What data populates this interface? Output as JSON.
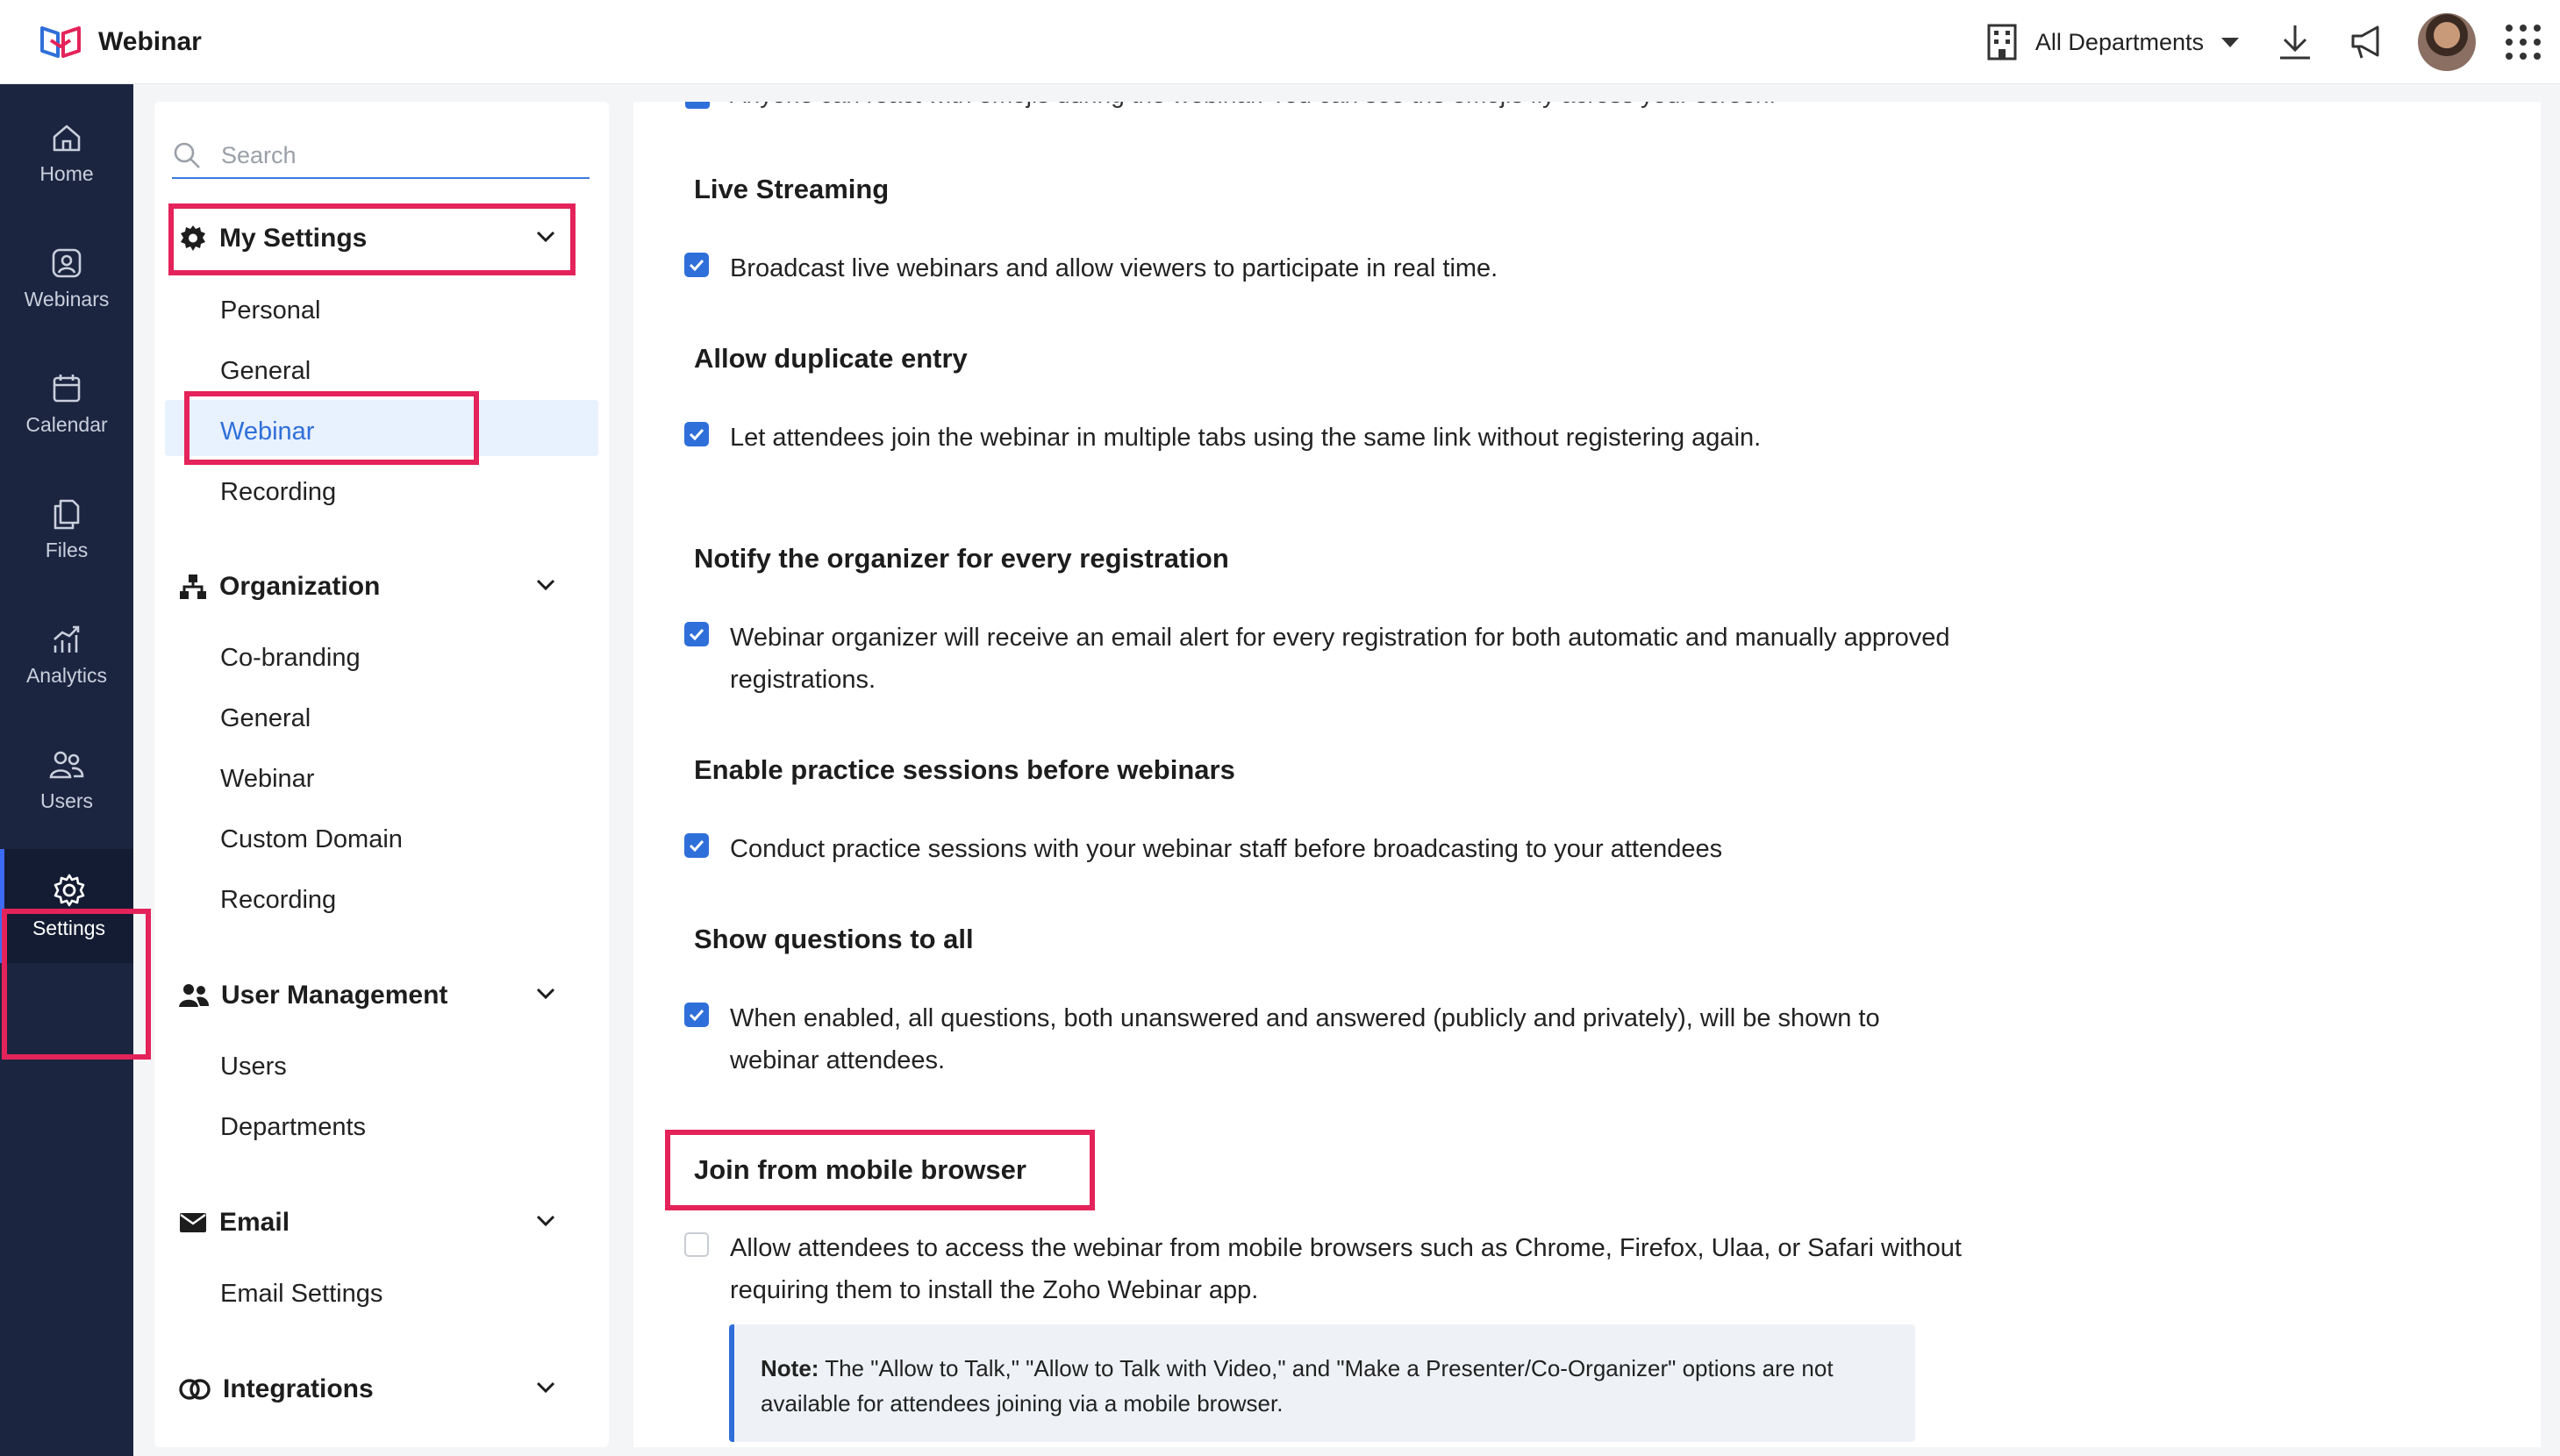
{
  "app": {
    "name": "Webinar",
    "brand_color": "#e4235a"
  },
  "topbar": {
    "department_selector": "All Departments",
    "icons": [
      "building-icon",
      "download-icon",
      "announcement-icon",
      "avatar",
      "apps-grid-icon"
    ]
  },
  "rail": {
    "items": [
      {
        "label": "Home",
        "icon": "home-icon"
      },
      {
        "label": "Webinars",
        "icon": "webinars-icon"
      },
      {
        "label": "Calendar",
        "icon": "calendar-icon"
      },
      {
        "label": "Files",
        "icon": "files-icon"
      },
      {
        "label": "Analytics",
        "icon": "analytics-icon"
      },
      {
        "label": "Users",
        "icon": "users-icon"
      },
      {
        "label": "Settings",
        "icon": "gear-icon",
        "active": true
      }
    ]
  },
  "sidebar": {
    "search_placeholder": "Search",
    "sections": [
      {
        "label": "My Settings",
        "icon": "gear-icon",
        "items": [
          "Personal",
          "General",
          "Webinar",
          "Recording"
        ],
        "active_item": "Webinar"
      },
      {
        "label": "Organization",
        "icon": "org-chart-icon",
        "items": [
          "Co-branding",
          "General",
          "Webinar",
          "Custom Domain",
          "Recording"
        ]
      },
      {
        "label": "User Management",
        "icon": "users-icon",
        "items": [
          "Users",
          "Departments"
        ]
      },
      {
        "label": "Email",
        "icon": "envelope-icon",
        "items": [
          "Email Settings"
        ]
      },
      {
        "label": "Integrations",
        "icon": "integrations-icon",
        "items": []
      }
    ]
  },
  "main": {
    "cut_off_text": "Anyone can react with emojis during the webinar. You can see the emojis fly across your screen.",
    "settings": [
      {
        "title": "Live Streaming",
        "text": "Broadcast live webinars and allow viewers to participate in real time.",
        "checked": true
      },
      {
        "title": "Allow duplicate entry",
        "text": "Let attendees join the webinar in multiple tabs using the same link without registering again.",
        "checked": true
      },
      {
        "title": "Notify the organizer for every registration",
        "text": "Webinar organizer will receive an email alert for every registration for both automatic and manually approved registrations.",
        "checked": true
      },
      {
        "title": "Enable practice sessions before webinars",
        "text": "Conduct practice sessions with your webinar staff before broadcasting to your attendees",
        "checked": true
      },
      {
        "title": "Show questions to all",
        "text": "When enabled, all questions, both unanswered and answered (publicly and privately), will be shown to webinar attendees.",
        "checked": true
      },
      {
        "title": "Join from mobile browser",
        "text": "Allow attendees to access the webinar from mobile browsers such as Chrome, Firefox, Ulaa, or Safari without requiring them to install the Zoho Webinar app.",
        "checked": false
      }
    ],
    "note": {
      "label": "Note:",
      "text": " The \"Allow to Talk,\" \"Allow to Talk with Video,\" and \"Make a Presenter/Co-Organizer\" options are not available for attendees joining via a mobile browser."
    }
  }
}
